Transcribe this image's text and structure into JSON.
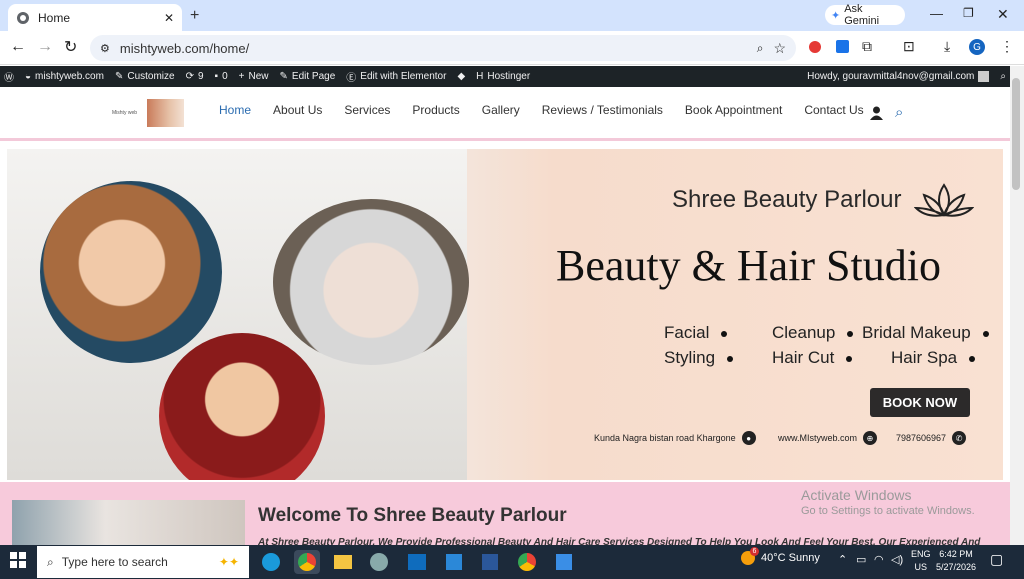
{
  "browser": {
    "tab_title": "Home",
    "url": "mishtyweb.com/home/",
    "ask_gemini": "Ask Gemini",
    "profile_initial": "G"
  },
  "wpbar": {
    "site": "mishtyweb.com",
    "customize": "Customize",
    "updates": "9",
    "comments": "0",
    "new": "New",
    "edit_page": "Edit Page",
    "elementor": "Edit with Elementor",
    "hostinger": "Hostinger",
    "howdy": "Howdy, gouravmittal4nov@gmail.com"
  },
  "site": {
    "logo_text": "Mishty web",
    "nav": [
      "Home",
      "About Us",
      "Services",
      "Products",
      "Gallery",
      "Reviews / Testimonials",
      "Book Appointment",
      "Contact Us"
    ]
  },
  "banner": {
    "brand": "Shree Beauty Parlour",
    "headline": "Beauty & Hair Studio",
    "services": [
      "Facial",
      "Cleanup",
      "Bridal Makeup",
      "Styling",
      "Hair Cut",
      "Hair Spa"
    ],
    "book_now": "BOOK NOW",
    "address": "Kunda Nagra bistan road Khargone",
    "website": "www.MIstyweb.com",
    "phone": "7987606967"
  },
  "section": {
    "title": "Welcome To Shree Beauty Parlour",
    "intro": "At Shree Beauty Parlour, We Provide Professional Beauty And Hair Care Services Designed To Help You Look And Feel Your Best. Our Experienced And"
  },
  "activate": {
    "title": "Activate Windows",
    "subtitle": "Go to Settings to activate Windows."
  },
  "taskbar": {
    "search_placeholder": "Type here to search",
    "weather": "40°C Sunny",
    "lang1": "ENG",
    "lang2": "US",
    "time": "6:42 PM",
    "date": "5/27/2026",
    "weather_badge": "6"
  },
  "colors": {
    "accent": "#2b6cb0",
    "wpbar": "#1d2327",
    "section_bg": "#f7cadb",
    "tabstrip": "#d3e3fd"
  }
}
